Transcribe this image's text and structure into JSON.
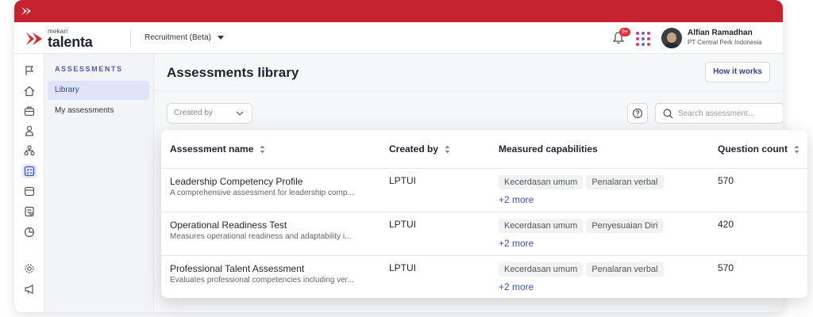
{
  "colors": {
    "brand_red": "#c4222f",
    "accent_blue": "#2f3ea8",
    "link_blue": "#3b4fc9"
  },
  "header": {
    "brand_small": "mekari",
    "brand_big": "talenta",
    "module": "Recruitment (Beta)",
    "notification_count": "9+",
    "user_name": "Alfian Ramadhan",
    "user_company": "PT Central Perk Indonesia"
  },
  "rail_icons": [
    "flag-icon",
    "home-icon",
    "briefcase-icon",
    "person-icon",
    "org-chart-icon",
    "assessment-icon",
    "calendar-icon",
    "document-icon",
    "pie-chart-icon",
    "settings-icon",
    "megaphone-icon"
  ],
  "sidebar": {
    "heading": "ASSESSMENTS",
    "items": [
      {
        "label": "Library",
        "active": true
      },
      {
        "label": "My assessments",
        "active": false
      }
    ]
  },
  "main": {
    "title": "Assessments library",
    "how_button": "How it works",
    "filter_label": "Created by",
    "search_placeholder": "Search assessment..."
  },
  "table": {
    "headers": [
      "Assessment name",
      "Created by",
      "Measured capabilities",
      "Question count"
    ],
    "rows": [
      {
        "name": "Leadership Competency Profile",
        "desc": "A comprehensive assessment for leadership comp...",
        "creator": "LPTUI",
        "tags": [
          "Kecerdasan umum",
          "Penalaran verbal"
        ],
        "more": "+2 more",
        "count": "570"
      },
      {
        "name": "Operational Readiness Test",
        "desc": "Measures operational readiness and adaptability i...",
        "creator": "LPTUI",
        "tags": [
          "Kecerdasan umum",
          "Penyesuaian Diri"
        ],
        "more": "+2 more",
        "count": "420"
      },
      {
        "name": "Professional Talent Assessment",
        "desc": "Evaluates professional competencies including ver...",
        "creator": "LPTUI",
        "tags": [
          "Kecerdasan umum",
          "Penalaran verbal"
        ],
        "more": "+2 more",
        "count": "570"
      }
    ]
  }
}
